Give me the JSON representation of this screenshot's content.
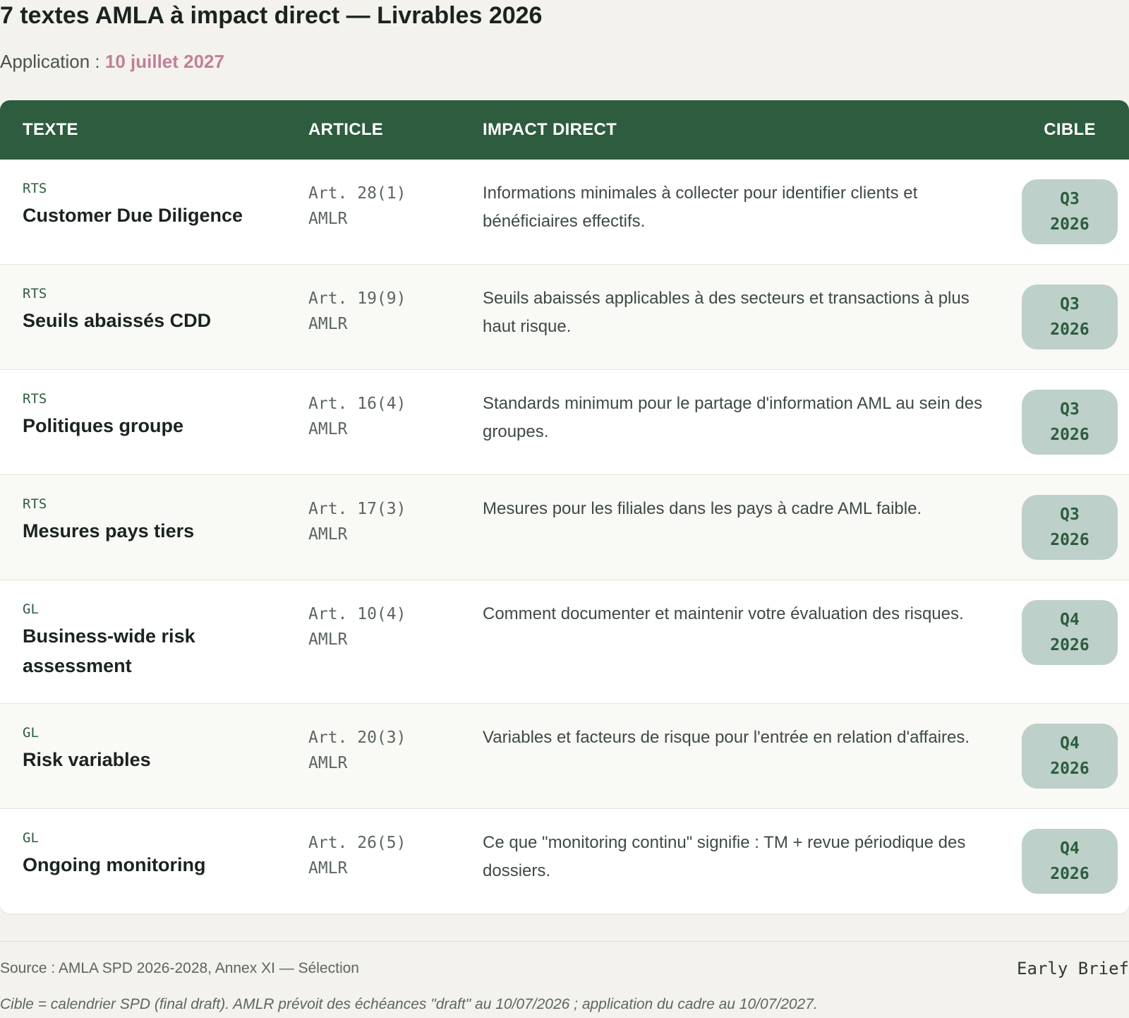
{
  "header": {
    "title": "7 textes AMLA à impact direct — Livrables 2026",
    "subtitle_label": "Application : ",
    "subtitle_date": "10 juillet 2027"
  },
  "table": {
    "columns": [
      "TEXTE",
      "ARTICLE",
      "IMPACT DIRECT",
      "CIBLE"
    ],
    "rows": [
      {
        "type": "RTS",
        "name": "Customer Due Diligence",
        "article": "Art. 28(1)",
        "regulation": "AMLR",
        "impact": "Informations minimales à collecter pour identifier clients et bénéficiaires effectifs.",
        "quarter": "Q3",
        "year": "2026"
      },
      {
        "type": "RTS",
        "name": "Seuils abaissés CDD",
        "article": "Art. 19(9)",
        "regulation": "AMLR",
        "impact": "Seuils abaissés applicables à des secteurs et transactions à plus haut risque.",
        "quarter": "Q3",
        "year": "2026"
      },
      {
        "type": "RTS",
        "name": "Politiques groupe",
        "article": "Art. 16(4)",
        "regulation": "AMLR",
        "impact": "Standards minimum pour le partage d'information AML au sein des groupes.",
        "quarter": "Q3",
        "year": "2026"
      },
      {
        "type": "RTS",
        "name": "Mesures pays tiers",
        "article": "Art. 17(3)",
        "regulation": "AMLR",
        "impact": "Mesures pour les filiales dans les pays à cadre AML faible.",
        "quarter": "Q3",
        "year": "2026"
      },
      {
        "type": "GL",
        "name": "Business-wide risk assessment",
        "article": "Art. 10(4)",
        "regulation": "AMLR",
        "impact": "Comment documenter et maintenir votre évaluation des risques.",
        "quarter": "Q4",
        "year": "2026"
      },
      {
        "type": "GL",
        "name": "Risk variables",
        "article": "Art. 20(3)",
        "regulation": "AMLR",
        "impact": "Variables et facteurs de risque pour l'entrée en relation d'affaires.",
        "quarter": "Q4",
        "year": "2026"
      },
      {
        "type": "GL",
        "name": "Ongoing monitoring",
        "article": "Art. 26(5)",
        "regulation": "AMLR",
        "impact": "Ce que \"monitoring continu\" signifie : TM + revue périodique des dossiers.",
        "quarter": "Q4",
        "year": "2026"
      }
    ]
  },
  "footer": {
    "source": "Source : AMLA SPD 2026-2028, Annex XI — Sélection",
    "brand": "Early Brief",
    "note": "Cible = calendrier SPD (final draft). AMLR prévoit des échéances \"draft\" au 10/07/2026 ; application du cadre au 10/07/2027."
  },
  "colors": {
    "header_bg": "#2d5c3e",
    "accent_date": "#c0809a",
    "badge_bg": "#bdd0c9",
    "page_bg": "#f4f2ec"
  }
}
